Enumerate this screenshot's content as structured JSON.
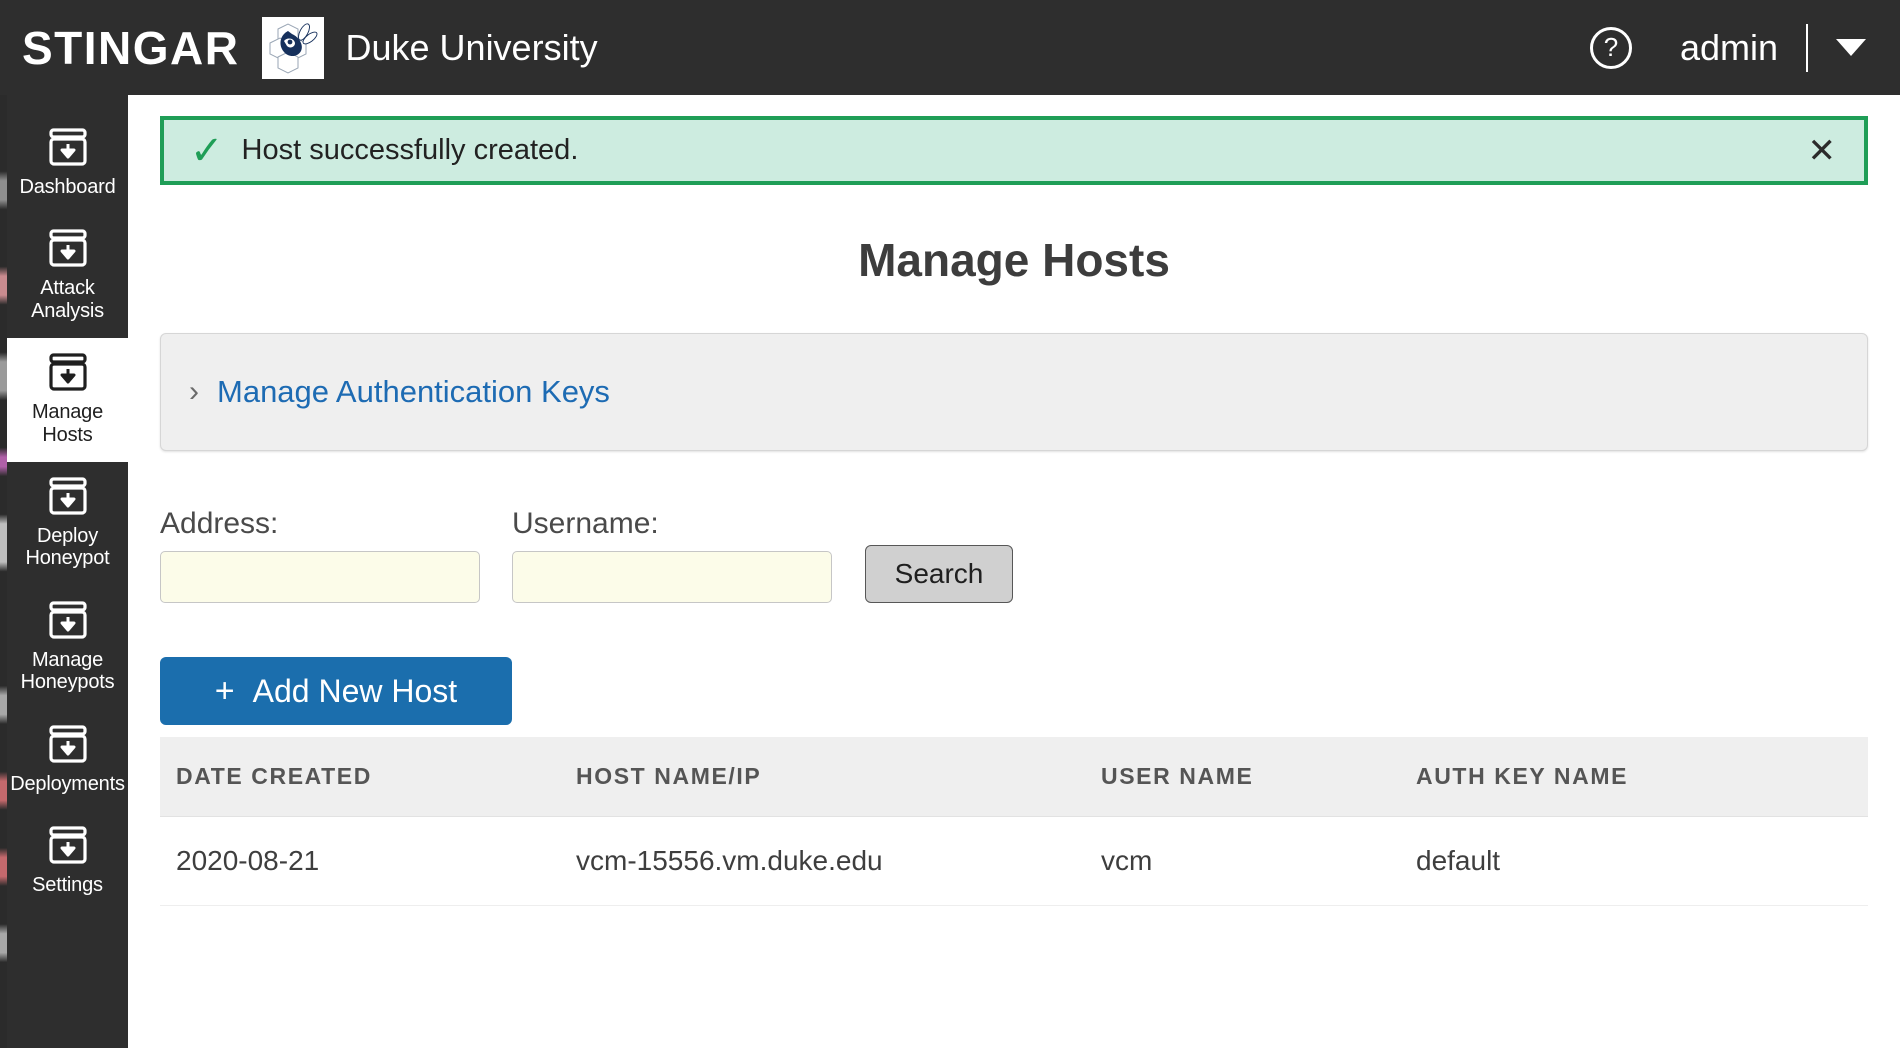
{
  "header": {
    "brand": "STINGAR",
    "org_name": "Duke University",
    "org_logo_name": "duke-blue-devil-logo",
    "help_icon": "question-circle-icon",
    "user": "admin",
    "caret_icon": "chevron-down-icon"
  },
  "sidebar": {
    "items": [
      {
        "label": "Dashboard",
        "icon": "archive-download-icon",
        "active": false
      },
      {
        "label": "Attack\nAnalysis",
        "icon": "archive-download-icon",
        "active": false
      },
      {
        "label": "Manage\nHosts",
        "icon": "archive-download-icon",
        "active": true
      },
      {
        "label": "Deploy\nHoneypot",
        "icon": "archive-download-icon",
        "active": false
      },
      {
        "label": "Manage\nHoneypots",
        "icon": "archive-download-icon",
        "active": false
      },
      {
        "label": "Deployments",
        "icon": "archive-download-icon",
        "active": false
      },
      {
        "label": "Settings",
        "icon": "archive-download-icon",
        "active": false
      }
    ]
  },
  "alert": {
    "icon": "check-icon",
    "message": "Host successfully created.",
    "close_icon": "close-icon",
    "close_label": "✕",
    "border_color": "#1f9e57",
    "background_color": "#cdece0"
  },
  "page": {
    "title": "Manage Hosts"
  },
  "auth_panel": {
    "chevron": "›",
    "link_label": "Manage Authentication Keys",
    "link_color": "#1d6bb3"
  },
  "search": {
    "address_label": "Address:",
    "address_value": "",
    "address_placeholder": "",
    "username_label": "Username:",
    "username_value": "",
    "username_placeholder": "",
    "button_label": "Search"
  },
  "actions": {
    "add_host_plus": "+",
    "add_host_label": "Add New Host",
    "add_host_color": "#1b6ead"
  },
  "table": {
    "columns": [
      "DATE CREATED",
      "HOST NAME/IP",
      "USER NAME",
      "AUTH KEY NAME"
    ],
    "rows": [
      {
        "date_created": "2020-08-21",
        "host_name_ip": "vcm-15556.vm.duke.edu",
        "user_name": "vcm",
        "auth_key_name": "default"
      }
    ]
  }
}
